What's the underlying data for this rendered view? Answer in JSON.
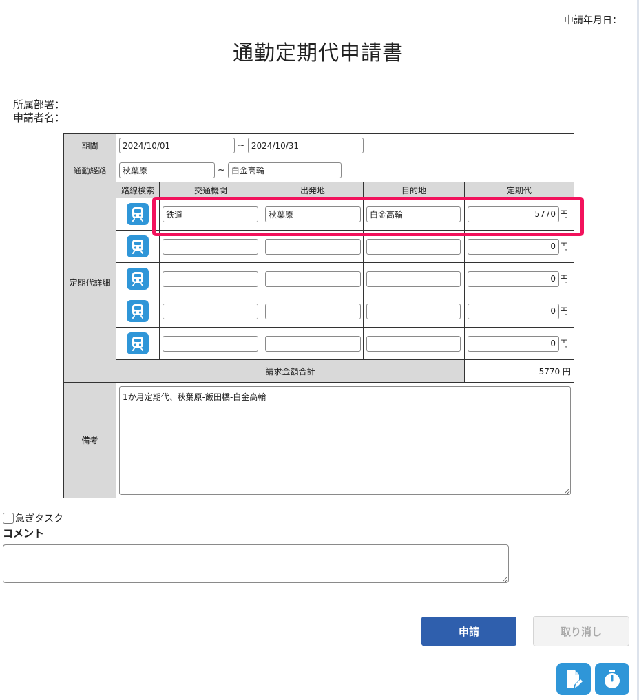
{
  "header": {
    "apply_date_label": "申請年月日：",
    "title": "通勤定期代申請書",
    "department_label": "所属部署：",
    "applicant_label": "申請者名："
  },
  "form": {
    "period_label": "期間",
    "period_from": "2024/10/01",
    "period_to": "2024/10/31",
    "period_separator": "~",
    "route_label": "通勤経路",
    "route_from": "秋葉原",
    "route_to": "白金高輪",
    "route_separator": "~",
    "detail_label": "定期代詳細",
    "columns": [
      "路線検索",
      "交通機関",
      "出発地",
      "目的地",
      "定期代"
    ],
    "currency": "円",
    "rows": [
      {
        "transport": "鉄道",
        "from": "秋葉原",
        "to": "白金高輪",
        "fare": "5770"
      },
      {
        "transport": "",
        "from": "",
        "to": "",
        "fare": "0"
      },
      {
        "transport": "",
        "from": "",
        "to": "",
        "fare": "0"
      },
      {
        "transport": "",
        "from": "",
        "to": "",
        "fare": "0"
      },
      {
        "transport": "",
        "from": "",
        "to": "",
        "fare": "0"
      }
    ],
    "total_label": "請求金額合計",
    "total_value": "5770 円",
    "remarks_label": "備考",
    "remarks_value": "1か月定期代、秋葉原-飯田橋-白金高輪"
  },
  "footer": {
    "urgent_label": "急ぎタスク",
    "urgent_checked": false,
    "comment_label": "コメント",
    "comment_value": "",
    "apply_button": "申請",
    "cancel_button": "取り消し"
  },
  "icons": {
    "route_search": "train-icon",
    "fab_edit": "edit-document-icon",
    "fab_timer": "stopwatch-icon"
  },
  "colors": {
    "accent_blue": "#2f96d8",
    "apply_button": "#2f5fad",
    "highlight": "#f2125c",
    "header_cell": "#d9d9d9"
  }
}
